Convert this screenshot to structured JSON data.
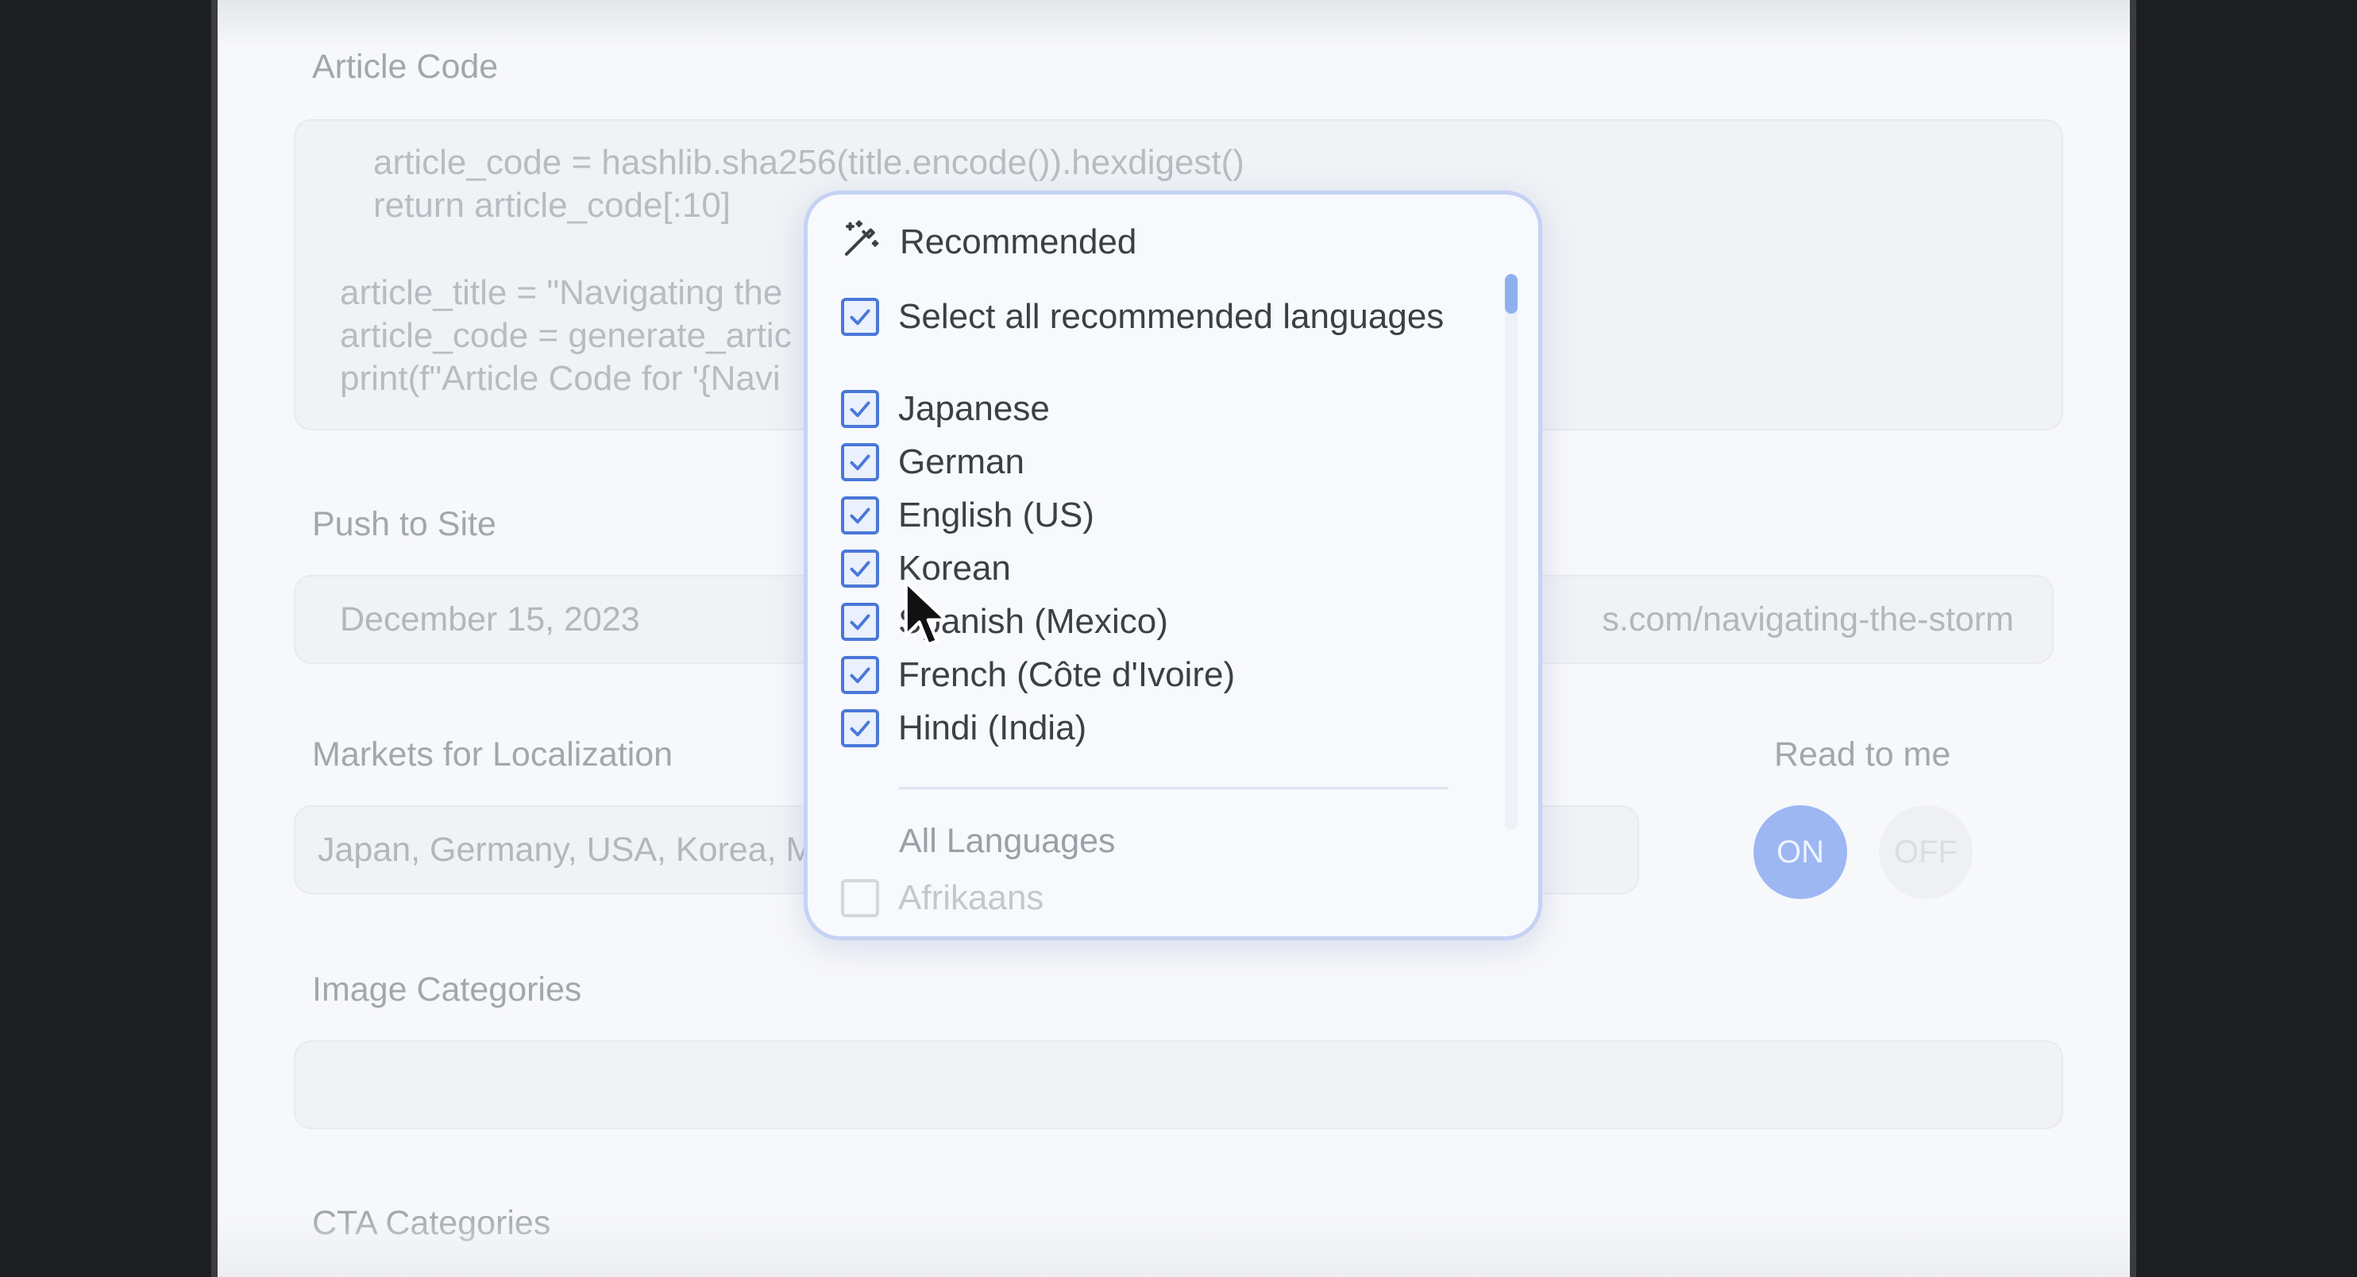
{
  "form": {
    "article_code": {
      "label": "Article Code",
      "code_lines": [
        "article_code = hashlib.sha256(title.encode()).hexdigest()",
        "return article_code[:10]",
        "article_title = \"Navigating the",
        "article_code = generate_artic",
        "print(f\"Article Code for '{Navi"
      ]
    },
    "push_to_site": {
      "label": "Push to Site",
      "date": "December 15, 2023",
      "url_fragment": "s.com/navigating-the-storm"
    },
    "markets": {
      "label": "Markets for Localization",
      "value": "Japan, Germany, USA, Korea, M"
    },
    "read_to_me": {
      "label": "Read to me",
      "on_label": "ON",
      "off_label": "OFF",
      "state": "on"
    },
    "image_categories": {
      "label": "Image Categories",
      "value": ""
    },
    "cta_categories": {
      "label": "CTA Categories"
    }
  },
  "dropdown": {
    "header": "Recommended",
    "header_icon": "magic-wand-icon",
    "select_all": {
      "label": "Select all recommended languages",
      "checked": true
    },
    "recommended": [
      {
        "label": "Japanese",
        "checked": true
      },
      {
        "label": "German",
        "checked": true
      },
      {
        "label": "English (US)",
        "checked": true
      },
      {
        "label": "Korean",
        "checked": true
      },
      {
        "label": "Spanish (Mexico)",
        "checked": true
      },
      {
        "label": "French (Côte d'Ivoire)",
        "checked": true
      },
      {
        "label": "Hindi (India)",
        "checked": true
      }
    ],
    "all_languages_label": "All Languages",
    "all_languages": [
      {
        "label": "Afrikaans",
        "checked": false
      }
    ]
  },
  "colors": {
    "accent": "#4a78d8",
    "toggle_on": "#9cb7f2",
    "dropdown_border": "#c5d2f4"
  }
}
